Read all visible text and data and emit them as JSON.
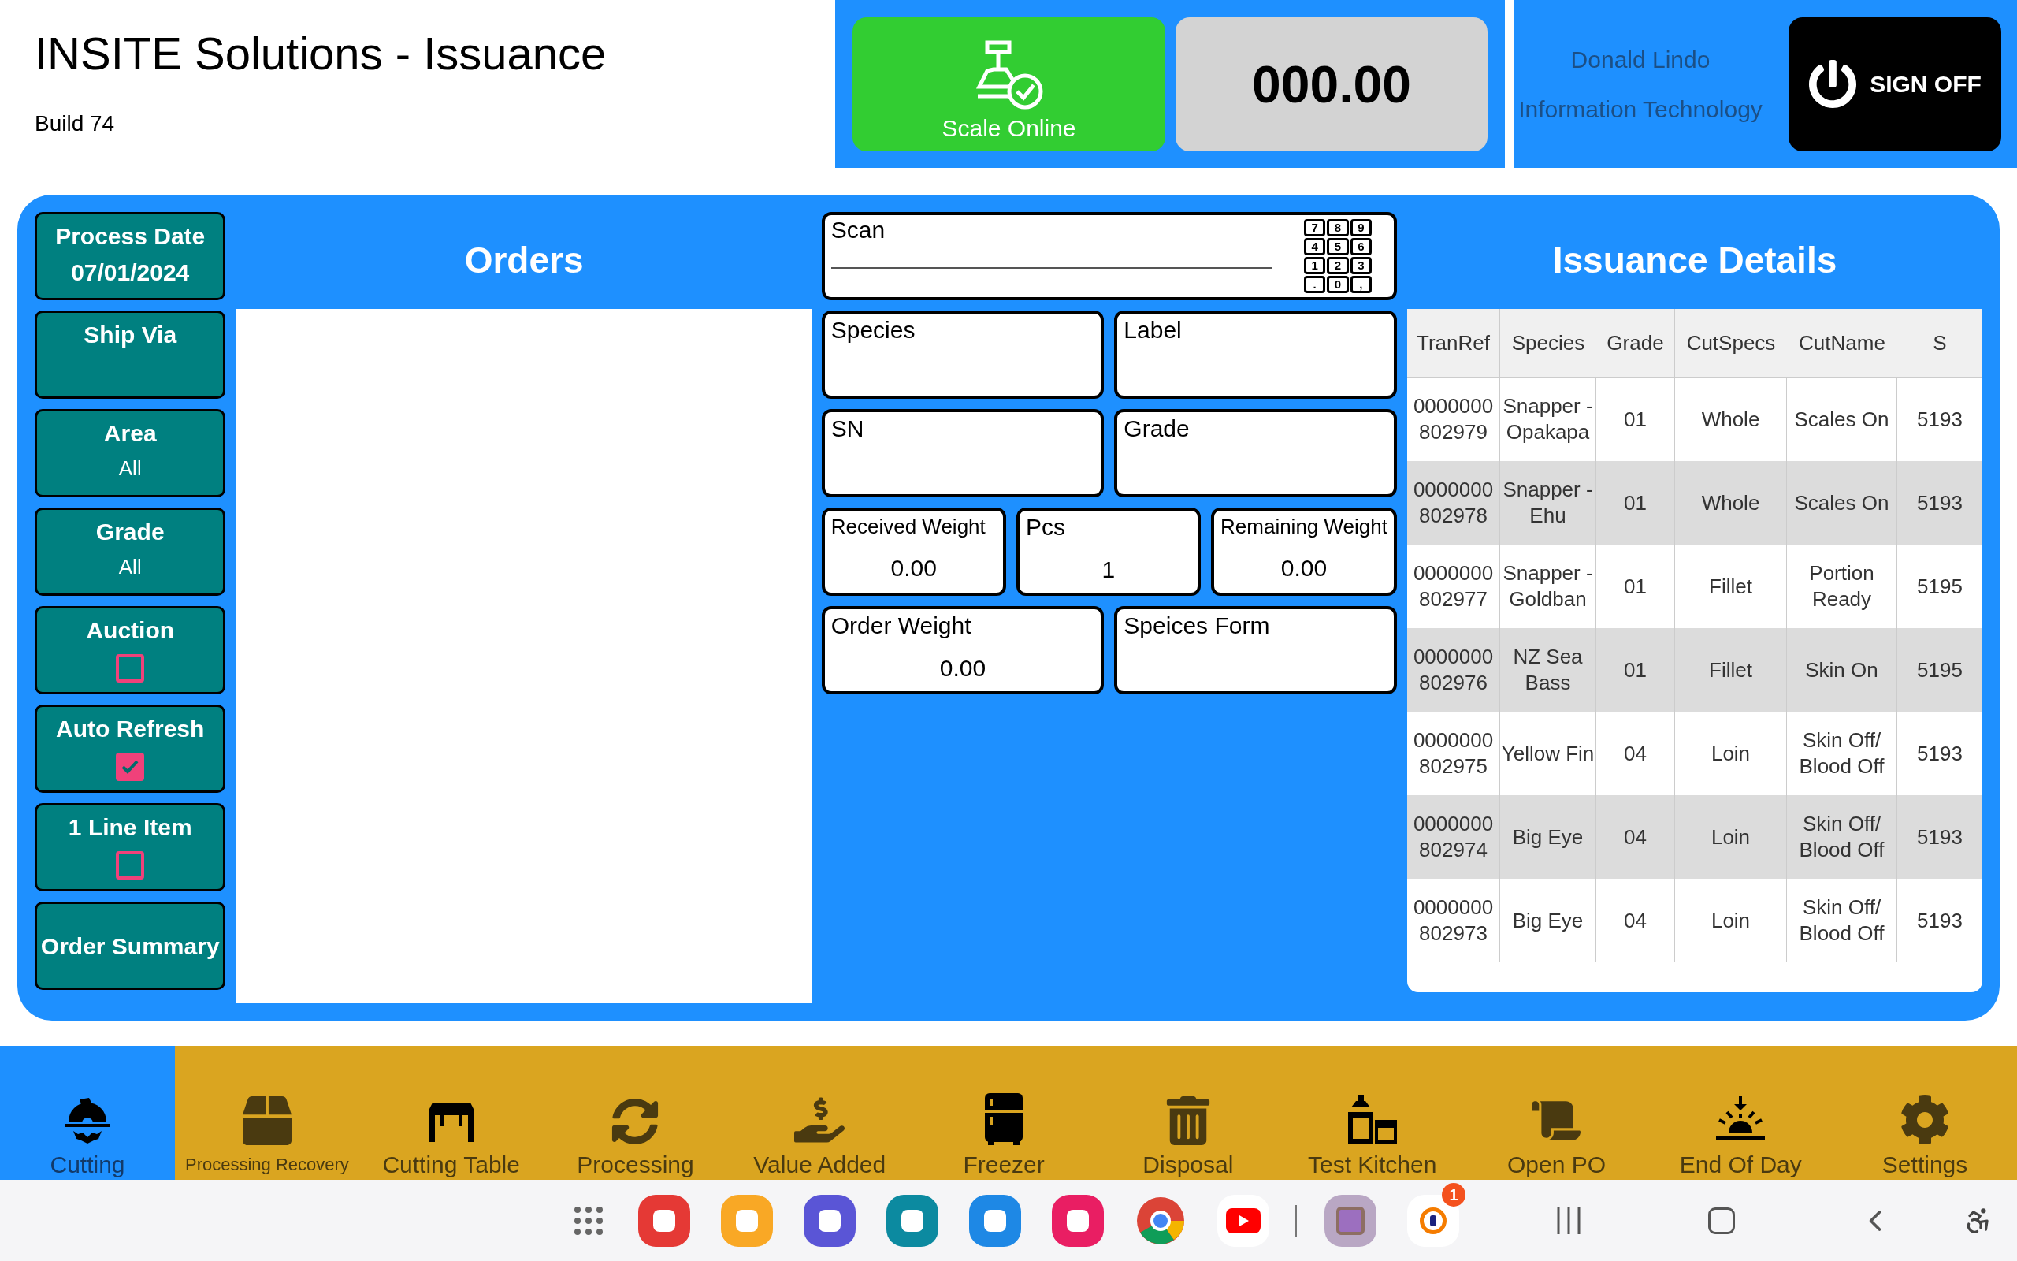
{
  "header": {
    "title": "INSITE Solutions - Issuance",
    "build": "Build 74"
  },
  "scale": {
    "status": "Scale Online",
    "online": true,
    "reading": "000.00"
  },
  "user": {
    "name": "Donald Lindo",
    "department": "Information Technology",
    "sign_off": "SIGN OFF"
  },
  "sidebar": {
    "items": [
      {
        "kind": "value",
        "label": "Process Date",
        "value": "07/01/2024"
      },
      {
        "kind": "value",
        "label": "Ship Via"
      },
      {
        "kind": "value",
        "label": "Area",
        "value": "All"
      },
      {
        "kind": "value",
        "label": "Grade",
        "value": "All"
      },
      {
        "kind": "checkbox",
        "label": "Auction",
        "checked": false
      },
      {
        "kind": "checkbox",
        "label": "Auto Refresh",
        "checked": true
      },
      {
        "kind": "checkbox",
        "label": "1 Line Item",
        "checked": false
      },
      {
        "kind": "button",
        "label": "Order Summary"
      }
    ]
  },
  "orders": {
    "title": "Orders"
  },
  "scan": {
    "label": "Scan",
    "keypad_keys": [
      "7",
      "8",
      "9",
      "4",
      "5",
      "6",
      "1",
      "2",
      "3",
      ".",
      "0",
      ","
    ]
  },
  "fields": [
    [
      {
        "label": "Species"
      },
      {
        "label": "Label"
      }
    ],
    [
      {
        "label": "SN"
      },
      {
        "label": "Grade"
      }
    ],
    [
      {
        "label": "Received Weight",
        "value": "0.00",
        "small": true
      },
      {
        "label": "Pcs",
        "value": "1"
      },
      {
        "label": "Remaining Weight",
        "value": "0.00",
        "small": true
      }
    ],
    [
      {
        "label": "Order Weight",
        "value": "0.00"
      },
      {
        "label": "Speices Form"
      }
    ]
  ],
  "issuance_details": {
    "title": "Issuance Details",
    "table": {
      "columns": [
        "TranRef",
        "Species",
        "Grade",
        "CutSpecs",
        "CutName",
        "S"
      ],
      "rows": [
        [
          "0000000 802979",
          "Snapper - Opakapa",
          "01",
          "Whole",
          "Scales On",
          "5193"
        ],
        [
          "0000000 802978",
          "Snapper - Ehu",
          "01",
          "Whole",
          "Scales On",
          "5193"
        ],
        [
          "0000000 802977",
          "Snapper - Goldban",
          "01",
          "Fillet",
          "Portion Ready",
          "5195"
        ],
        [
          "0000000 802976",
          "NZ Sea Bass",
          "01",
          "Fillet",
          "Skin On",
          "5195"
        ],
        [
          "0000000 802975",
          "Yellow Fin",
          "04",
          "Loin",
          "Skin Off/ Blood Off",
          "5193"
        ],
        [
          "0000000 802974",
          "Big Eye",
          "04",
          "Loin",
          "Skin Off/ Blood Off",
          "5193"
        ],
        [
          "0000000 802973",
          "Big Eye",
          "04",
          "Loin",
          "Skin Off/ Blood Off",
          "5193"
        ]
      ]
    }
  },
  "nav": [
    {
      "label": "Cutting",
      "selected": true
    },
    {
      "label": "Processing Recovery",
      "selected": false,
      "small": true
    },
    {
      "label": "Cutting Table",
      "selected": false
    },
    {
      "label": "Processing",
      "selected": false
    },
    {
      "label": "Value Added",
      "selected": false
    },
    {
      "label": "Freezer",
      "selected": false
    },
    {
      "label": "Disposal",
      "selected": false
    },
    {
      "label": "Test Kitchen",
      "selected": false
    },
    {
      "label": "Open PO",
      "selected": false
    },
    {
      "label": "End Of Day",
      "selected": false
    },
    {
      "label": "Settings",
      "selected": false
    }
  ],
  "system_bar": {
    "badge": "1"
  }
}
